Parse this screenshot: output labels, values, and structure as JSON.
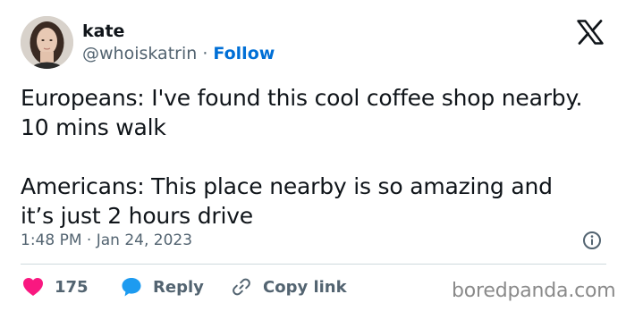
{
  "author": {
    "display_name": "kate",
    "handle": "@whoiskatrin",
    "separator": " · ",
    "follow_label": "Follow"
  },
  "tweet": {
    "text": "Europeans: I've found this cool coffee shop nearby.\n10 mins walk\n\nAmericans: This place nearby is so amazing and\nit’s just 2 hours drive",
    "timestamp": "1:48 PM · Jan 24, 2023"
  },
  "actions": {
    "like_count": "175",
    "reply_label": "Reply",
    "copy_link_label": "Copy link"
  },
  "watermark": "boredpanda.com",
  "icons": {
    "logo": "x-logo-icon",
    "info": "info-icon",
    "like": "heart-icon",
    "reply": "speech-bubble-icon",
    "copy_link": "link-icon"
  },
  "colors": {
    "text": "#0f1419",
    "secondary": "#536471",
    "follow": "#006fd6",
    "like": "#f91880",
    "reply": "#1d9bf0",
    "divider": "#cfd9de"
  }
}
